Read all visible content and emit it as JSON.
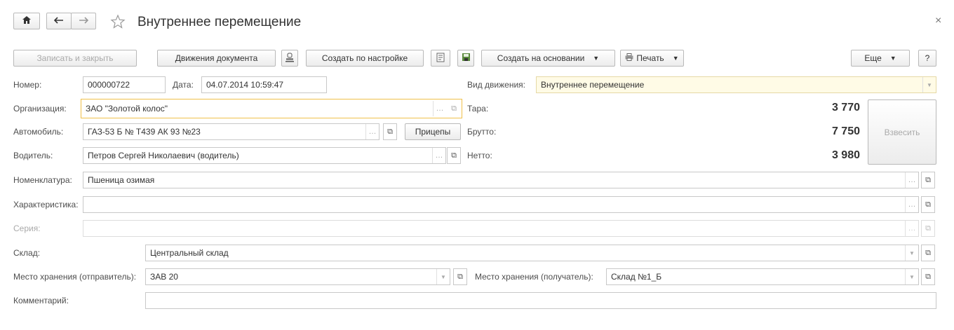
{
  "header": {
    "title": "Внутреннее перемещение",
    "close_glyph": "×"
  },
  "toolbar": {
    "save_close": "Записать и закрыть",
    "doc_movements": "Движения документа",
    "create_by_setting": "Создать по настройке",
    "create_based_on": "Создать на основании",
    "print": "Печать",
    "more": "Еще",
    "help": "?"
  },
  "form": {
    "number_label": "Номер:",
    "number_value": "000000722",
    "date_label": "Дата:",
    "date_value": "04.07.2014 10:59:47",
    "movement_type_label": "Вид движения:",
    "movement_type_value": "Внутреннее перемещение",
    "organization_label": "Организация:",
    "organization_value": "ЗАО \"Золотой колос\"",
    "vehicle_label": "Автомобиль:",
    "vehicle_value": "ГАЗ-53 Б № Т439 АК 93 №23",
    "trailers_button": "Прицепы",
    "driver_label": "Водитель:",
    "driver_value": "Петров Сергей Николаевич (водитель)",
    "nomenclature_label": "Номенклатура:",
    "nomenclature_value": "Пшеница озимая",
    "characteristic_label": "Характеристика:",
    "characteristic_value": "",
    "series_label": "Серия:",
    "series_value": "",
    "warehouse_label": "Склад:",
    "warehouse_value": "Центральный склад",
    "storage_sender_label": "Место хранения (отправитель):",
    "storage_sender_value": "ЗАВ 20",
    "storage_receiver_label": "Место хранения (получатель):",
    "storage_receiver_value": "Склад №1_Б",
    "comment_label": "Комментарий:",
    "comment_value": ""
  },
  "weights": {
    "tare_label": "Тара:",
    "tare_value": "3 770",
    "gross_label": "Брутто:",
    "gross_value": "7 750",
    "net_label": "Нетто:",
    "net_value": "3 980",
    "weigh_button": "Взвесить"
  },
  "icons": {
    "home": "home-icon",
    "back": "arrow-left-icon",
    "forward": "arrow-right-icon",
    "favorite": "star-icon",
    "close": "close-icon",
    "stamp": "stamp-icon",
    "report": "report-icon",
    "save_disk": "disk-icon",
    "printer": "printer-icon"
  },
  "colors": {
    "focus_border": "#f0c04a",
    "highlight_field": "#fffbe6",
    "button_border": "#b9b9b9"
  }
}
